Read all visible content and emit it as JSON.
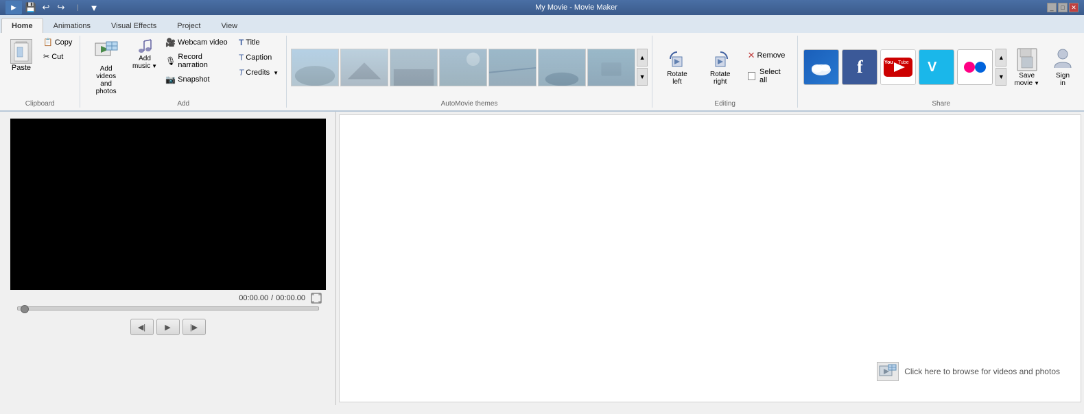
{
  "titlebar": {
    "title": "My Movie - Movie Maker",
    "quickaccess": [
      "save-icon",
      "undo-icon",
      "redo-icon",
      "customize-icon"
    ]
  },
  "tabs": [
    {
      "id": "home",
      "label": "Home",
      "active": true
    },
    {
      "id": "animations",
      "label": "Animations",
      "active": false
    },
    {
      "id": "visual-effects",
      "label": "Visual Effects",
      "active": false
    },
    {
      "id": "project",
      "label": "Project",
      "active": false
    },
    {
      "id": "view",
      "label": "View",
      "active": false
    }
  ],
  "ribbon": {
    "clipboard": {
      "label": "Clipboard",
      "paste": "Paste",
      "copy": "Copy",
      "cut": "Cut"
    },
    "add": {
      "label": "Add",
      "add_videos_photos": "Add videos\nand photos",
      "add_music": "Add\nmusic",
      "webcam_video": "Webcam video",
      "record_narration": "Record narration",
      "snapshot": "Snapshot",
      "title": "Title",
      "caption": "Caption",
      "credits": "Credits"
    },
    "automovie": {
      "label": "AutoMovie themes"
    },
    "editing": {
      "label": "Editing",
      "rotate_left": "Rotate\nleft",
      "rotate_right": "Rotate\nright",
      "remove": "Remove",
      "select_all": "Select all"
    },
    "share": {
      "label": "Share",
      "save_movie": "Save\nmovie",
      "sign_in": "Sign\nin"
    }
  },
  "preview": {
    "time_current": "00:00.00",
    "time_total": "00:00.00",
    "time_separator": "/"
  },
  "storyboard": {
    "hint": "Click here to browse for videos and photos"
  },
  "playback": {
    "rewind": "◀|",
    "play": "▶",
    "forward": "|▶"
  }
}
